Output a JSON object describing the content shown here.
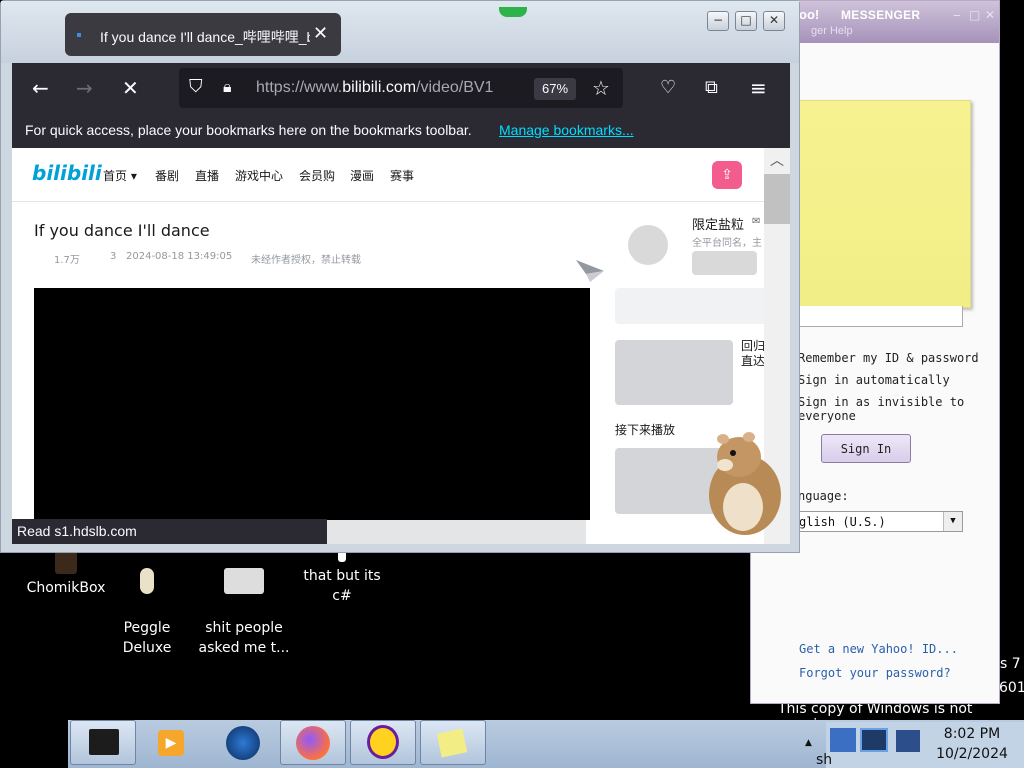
{
  "desktop": {
    "icons": [
      {
        "label": "ChomikBox"
      },
      {
        "label": "Peggle\nDeluxe"
      },
      {
        "label": "shit people\nasked me t..."
      },
      {
        "label": "that but its c#"
      }
    ],
    "watermark": {
      "line1": "s 7",
      "line2": "601",
      "line3": "This copy of Windows is not genuine"
    }
  },
  "yahoo": {
    "title": "MESSENGER",
    "title_prefix": "oo!",
    "menu": "ger   Help",
    "remember": "Remember my ID & password",
    "auto": "Sign in automatically",
    "invisible": "Sign in as invisible to everyone",
    "signin": "Sign In",
    "language_label": "nguage:",
    "language_value": "glish (U.S.)",
    "new_id": "Get a new Yahoo! ID...",
    "forgot": "Forgot your password?"
  },
  "browser": {
    "tab_title": "If you dance I'll dance_哔哩哔哩_bilibili",
    "url_prefix": "https://www.",
    "url_domain": "bilibili.com",
    "url_path": "/video/BV1",
    "zoom": "67%",
    "bookmarks_text": "For quick access, place your bookmarks here on the bookmarks toolbar.",
    "bookmarks_link": "Manage bookmarks...",
    "status": "Read s1.hdslb.com"
  },
  "bilibili": {
    "logo": "bilibili",
    "nav": [
      "首页",
      "番剧",
      "直播",
      "游戏中心",
      "会员购",
      "漫画",
      "赛事"
    ],
    "video_title": "If you dance I'll dance",
    "views": "1.7万",
    "danmaku": "3",
    "datetime": "2024-08-18 13:49:05",
    "notice": "未经作者授权，禁止转载",
    "uploader_name": "限定盐粒",
    "uploader_desc": "全平台同名，主",
    "side_text1": "回归",
    "side_text2": "直达",
    "up_next": "接下来播放"
  },
  "taskbar": {
    "time": "8:02 PM",
    "date": "10/2/2024",
    "tray_text": "sh"
  },
  "colors": {
    "bilibili_blue": "#00a1d6",
    "upload_pink": "#f25d8e",
    "firefox_dark": "#2b2a33",
    "link_blue": "#00ddff"
  }
}
